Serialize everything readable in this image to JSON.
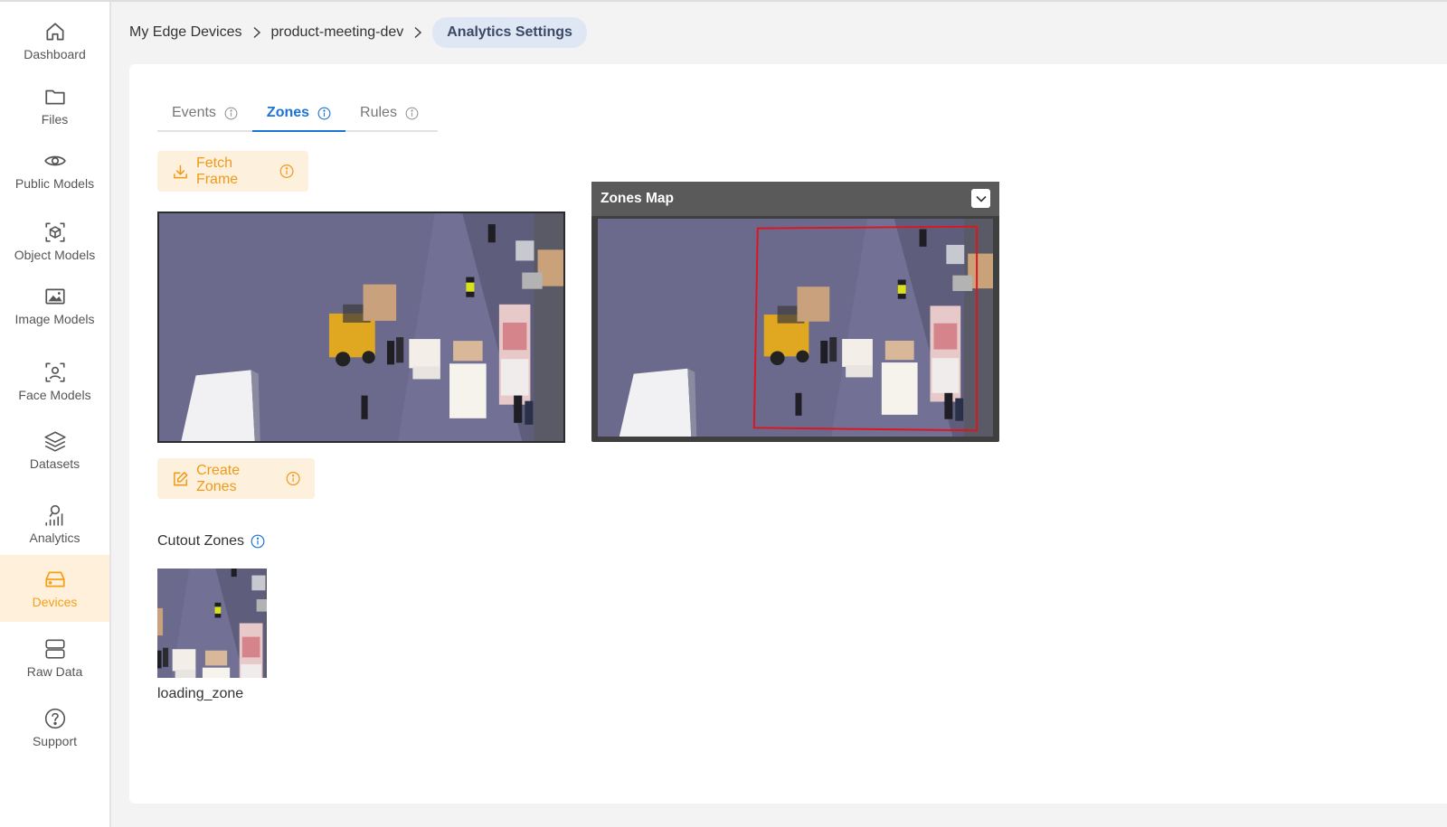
{
  "sidebar": {
    "items": [
      {
        "label": "Dashboard",
        "icon": "home-icon",
        "active": false
      },
      {
        "label": "Files",
        "icon": "folder-icon",
        "active": false
      },
      {
        "label": "Public Models",
        "icon": "eye-icon",
        "active": false
      },
      {
        "label": "Object Models",
        "icon": "cube-icon",
        "active": false
      },
      {
        "label": "Image Models",
        "icon": "image-icon",
        "active": false
      },
      {
        "label": "Face Models",
        "icon": "face-scan-icon",
        "active": false
      },
      {
        "label": "Datasets",
        "icon": "layers-icon",
        "active": false
      },
      {
        "label": "Analytics",
        "icon": "analytics-icon",
        "active": false
      },
      {
        "label": "Devices",
        "icon": "device-icon",
        "active": true
      },
      {
        "label": "Raw Data",
        "icon": "server-icon",
        "active": false
      },
      {
        "label": "Support",
        "icon": "help-icon",
        "active": false
      }
    ]
  },
  "breadcrumb": {
    "items": [
      "My Edge Devices",
      "product-meeting-dev"
    ],
    "current": "Analytics Settings"
  },
  "tabs": [
    {
      "label": "Events",
      "active": false
    },
    {
      "label": "Zones",
      "active": true
    },
    {
      "label": "Rules",
      "active": false
    }
  ],
  "actions": {
    "fetch_frame": "Fetch Frame",
    "create_zones": "Create Zones"
  },
  "zones_map": {
    "title": "Zones Map"
  },
  "cutout_zones": {
    "title": "Cutout Zones",
    "items": [
      {
        "name": "loading_zone"
      }
    ]
  },
  "colors": {
    "accent": "#1a73d6",
    "orange": "#f19a1a",
    "orange_bg": "#fdf0dc",
    "active_nav_bg": "#fff0dc",
    "zone_outline": "#e0141e"
  }
}
